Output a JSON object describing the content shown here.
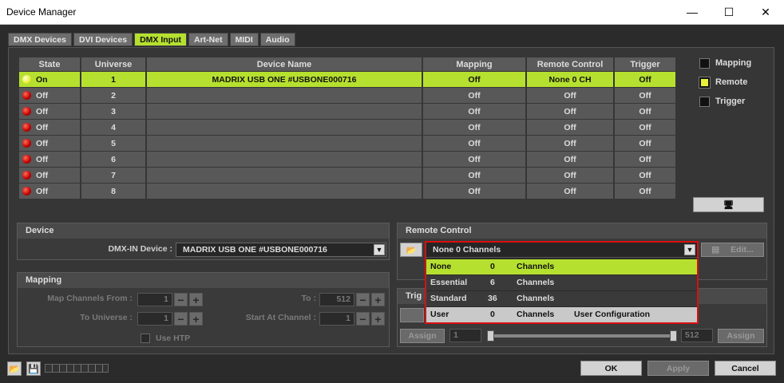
{
  "window": {
    "title": "Device Manager",
    "minimize_icon": "minimize-icon",
    "maximize_icon": "maximize-icon",
    "close_icon": "close-icon"
  },
  "tabs": [
    {
      "label": "DMX Devices",
      "active": false
    },
    {
      "label": "DVI Devices",
      "active": false
    },
    {
      "label": "DMX Input",
      "active": true
    },
    {
      "label": "Art-Net",
      "active": false
    },
    {
      "label": "MIDI",
      "active": false
    },
    {
      "label": "Audio",
      "active": false
    }
  ],
  "table": {
    "headers": [
      "State",
      "Universe",
      "Device Name",
      "Mapping",
      "Remote Control",
      "Trigger"
    ],
    "rows": [
      {
        "state": "On",
        "universe": "1",
        "device": "MADRIX USB ONE #USBONE000716",
        "mapping": "Off",
        "remote": "None  0 CH",
        "trigger": "Off",
        "selected": true
      },
      {
        "state": "Off",
        "universe": "2",
        "device": "",
        "mapping": "Off",
        "remote": "Off",
        "trigger": "Off",
        "selected": false
      },
      {
        "state": "Off",
        "universe": "3",
        "device": "",
        "mapping": "Off",
        "remote": "Off",
        "trigger": "Off",
        "selected": false
      },
      {
        "state": "Off",
        "universe": "4",
        "device": "",
        "mapping": "Off",
        "remote": "Off",
        "trigger": "Off",
        "selected": false
      },
      {
        "state": "Off",
        "universe": "5",
        "device": "",
        "mapping": "Off",
        "remote": "Off",
        "trigger": "Off",
        "selected": false
      },
      {
        "state": "Off",
        "universe": "6",
        "device": "",
        "mapping": "Off",
        "remote": "Off",
        "trigger": "Off",
        "selected": false
      },
      {
        "state": "Off",
        "universe": "7",
        "device": "",
        "mapping": "Off",
        "remote": "Off",
        "trigger": "Off",
        "selected": false
      },
      {
        "state": "Off",
        "universe": "8",
        "device": "",
        "mapping": "Off",
        "remote": "Off",
        "trigger": "Off",
        "selected": false
      }
    ]
  },
  "legend": [
    {
      "label": "Mapping",
      "active": false
    },
    {
      "label": "Remote",
      "active": true
    },
    {
      "label": "Trigger",
      "active": false
    }
  ],
  "monitor_icon": "monitor-icon",
  "device_panel": {
    "title": "Device",
    "dmx_in_label": "DMX-IN Device :",
    "dmx_in_value": "MADRIX USB ONE #USBONE000716"
  },
  "mapping_panel": {
    "title": "Mapping",
    "map_from_label": "Map Channels From :",
    "map_from_value": "1",
    "to_label": "To :",
    "to_value": "512",
    "to_universe_label": "To Universe :",
    "to_universe_value": "1",
    "start_channel_label": "Start At Channel :",
    "start_channel_value": "1",
    "use_htp_label": "Use HTP"
  },
  "remote_panel": {
    "title": "Remote Control",
    "selected": "None   0 Channels",
    "edit_label": "Edit...",
    "options": [
      {
        "name": "None",
        "count": "0",
        "unit": "Channels",
        "extra": "",
        "state": "selected"
      },
      {
        "name": "Essential",
        "count": "6",
        "unit": "Channels",
        "extra": "",
        "state": "normal"
      },
      {
        "name": "Standard",
        "count": "36",
        "unit": "Channels",
        "extra": "",
        "state": "normal"
      },
      {
        "name": "User",
        "count": "0",
        "unit": "Channels",
        "extra": "User Configuration",
        "state": "hover"
      }
    ]
  },
  "trigger_panel": {
    "title_partial": "Trig",
    "assign_left": "Assign",
    "range_from": "1",
    "range_to": "512",
    "assign_right": "Assign"
  },
  "footer": {
    "ok": "OK",
    "apply": "Apply",
    "cancel": "Cancel"
  }
}
